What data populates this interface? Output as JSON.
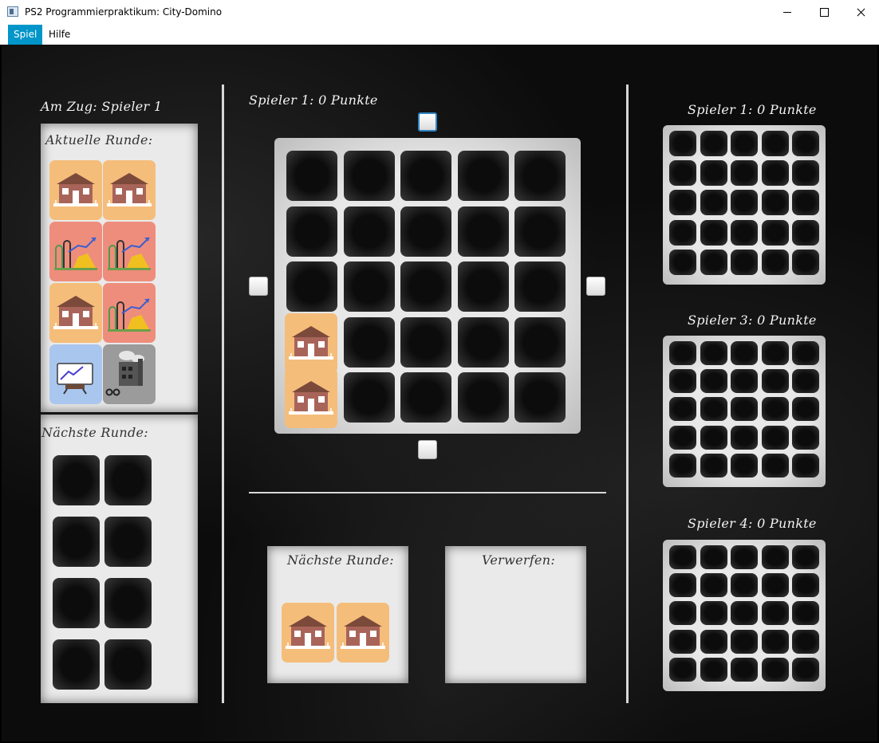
{
  "window": {
    "title": "PS2 Programmierpraktikum: City-Domino"
  },
  "menubar": {
    "items": [
      "Spiel",
      "Hilfe"
    ],
    "active": "Spiel",
    "accent": "#0096c9"
  },
  "left": {
    "turn_label": "Am Zug: Spieler 1",
    "current_round": {
      "label": "Aktuelle Runde:",
      "dominoes": [
        [
          "house-tile",
          "house-tile"
        ],
        [
          "industry-tile",
          "industry-tile"
        ],
        [
          "house-tile",
          "industry-tile"
        ],
        [
          "office-tile",
          "factory-tile"
        ]
      ]
    },
    "next_round": {
      "label": "Nächste Runde:",
      "empty_slots": 8
    }
  },
  "center": {
    "board_title": "Spieler 1: 0 Punkte",
    "grid": {
      "rows": 5,
      "cols": 5,
      "placed": [
        {
          "row": 4,
          "col": 1,
          "tile": "house-tile"
        },
        {
          "row": 5,
          "col": 1,
          "tile": "house-tile"
        }
      ]
    },
    "next_round_box": {
      "label": "Nächste Runde:",
      "dominoes": [
        "house-tile",
        "house-tile"
      ]
    },
    "discard_box": {
      "label": "Verwerfen:"
    }
  },
  "right": {
    "boards": [
      {
        "title": "Spieler 1: 0 Punkte"
      },
      {
        "title": "Spieler 3: 0 Punkte"
      },
      {
        "title": "Spieler 4: 0 Punkte"
      }
    ]
  },
  "colors": {
    "house": "#f5bd7a",
    "industry": "#ef8d7c",
    "office": "#a9c6ee",
    "factory": "#9b9b9b"
  }
}
